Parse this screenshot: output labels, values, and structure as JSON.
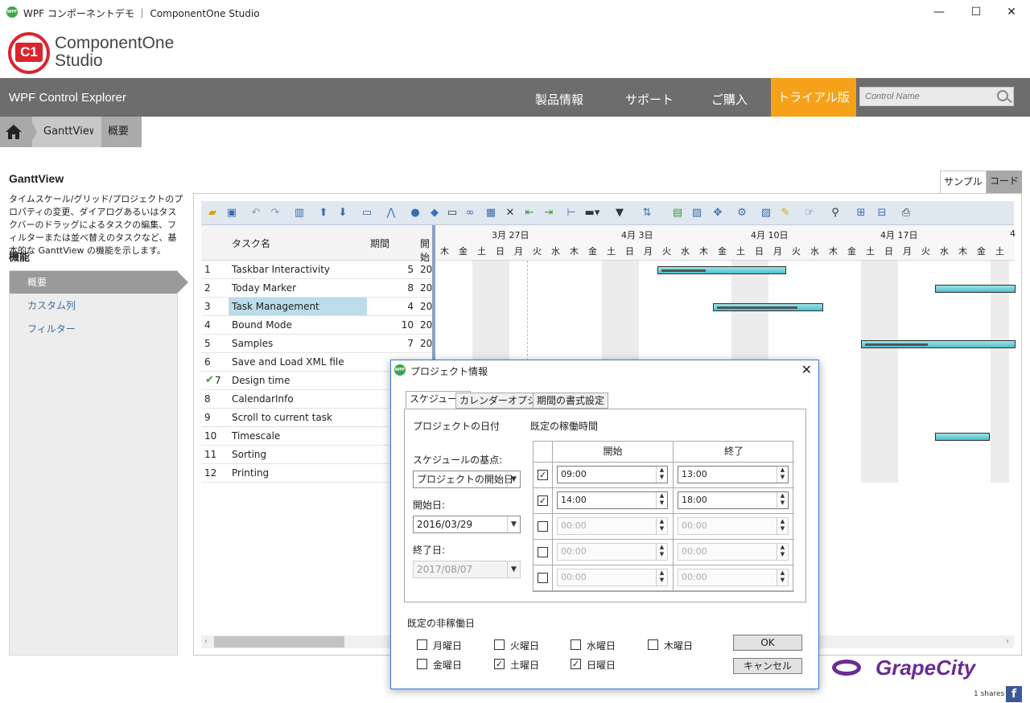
{
  "window": {
    "title": "WPF コンポーネントデモ ｜ ComponentOne Studio",
    "app_icon": "WPF"
  },
  "logo": {
    "mark": "C1",
    "line1": "ComponentOne",
    "line2": "Studio"
  },
  "navbar": {
    "app_title": "WPF Control Explorer",
    "items": [
      "製品情報",
      "サポート",
      "ご購入"
    ],
    "trial": "トライアル版",
    "search_placeholder": "Control Name"
  },
  "breadcrumb": [
    "GanttView",
    "概要"
  ],
  "sidebar": {
    "title": "GanttView",
    "description": "タイムスケール/グリッド/プロジェクトのプロパティの変更、ダイアログあるいはタスクバーのドラッグによるタスクの編集、フィルターまたは並べ替えのタスクなど、基本的な GanttView の機能を示します。",
    "features_label": "機能",
    "items": [
      "概要",
      "カスタム列",
      "フィルター"
    ]
  },
  "tabs": {
    "sample": "サンプル",
    "code": "コード"
  },
  "grid": {
    "columns": {
      "name": "タスク名",
      "duration": "期間",
      "start": "開始"
    },
    "rows": [
      {
        "n": "1",
        "name": "Taskbar Interactivity",
        "dur": "5",
        "start": "20"
      },
      {
        "n": "2",
        "name": "Today Marker",
        "dur": "8",
        "start": "20"
      },
      {
        "n": "3",
        "name": "Task Management",
        "dur": "4",
        "start": "20"
      },
      {
        "n": "4",
        "name": "Bound Mode",
        "dur": "10",
        "start": "20"
      },
      {
        "n": "5",
        "name": "Samples",
        "dur": "7",
        "start": "20"
      },
      {
        "n": "6",
        "name": "Save and Load XML file",
        "dur": "",
        "start": ""
      },
      {
        "n": "7",
        "name": "Design time",
        "dur": "",
        "start": ""
      },
      {
        "n": "8",
        "name": "CalendarInfo",
        "dur": "",
        "start": ""
      },
      {
        "n": "9",
        "name": "Scroll to current task",
        "dur": "",
        "start": ""
      },
      {
        "n": "10",
        "name": "Timescale",
        "dur": "",
        "start": ""
      },
      {
        "n": "11",
        "name": "Sorting",
        "dur": "",
        "start": ""
      },
      {
        "n": "12",
        "name": "Printing",
        "dur": "",
        "start": ""
      }
    ]
  },
  "chart": {
    "weeks": [
      "3月 27日",
      "4月 3日",
      "4月 10日",
      "4月 17日",
      "4"
    ],
    "days": [
      "木",
      "金",
      "土",
      "日",
      "月",
      "火",
      "水",
      "木",
      "金",
      "土",
      "日",
      "月",
      "火",
      "水",
      "木",
      "金",
      "土",
      "日",
      "月",
      "火",
      "水",
      "木",
      "金",
      "土",
      "日",
      "月",
      "火",
      "水",
      "木",
      "金",
      "土"
    ]
  },
  "dialog": {
    "title": "プロジェクト情報",
    "tabs": [
      "スケジュール",
      "カレンダーオプション",
      "期間の書式設定"
    ],
    "project_date_label": "プロジェクトの日付",
    "work_hours_label": "既定の稼働時間",
    "schedule_base_label": "スケジュールの基点:",
    "schedule_base_value": "プロジェクトの開始日",
    "start_label": "開始日:",
    "start_value": "2016/03/29",
    "end_label": "終了日:",
    "end_value": "2017/08/07",
    "hours_header": {
      "start": "開始",
      "end": "終了"
    },
    "hours": [
      {
        "checked": "✓",
        "start": "09:00",
        "end": "13:00"
      },
      {
        "checked": "✓",
        "start": "14:00",
        "end": "18:00"
      },
      {
        "checked": "",
        "start": "00:00",
        "end": "00:00"
      },
      {
        "checked": "",
        "start": "00:00",
        "end": "00:00"
      },
      {
        "checked": "",
        "start": "00:00",
        "end": "00:00"
      }
    ],
    "nonwork_label": "既定の非稼働日",
    "weekdays": {
      "mon": "月曜日",
      "tue": "火曜日",
      "wed": "水曜日",
      "thu": "木曜日",
      "fri": "金曜日",
      "sat": "土曜日",
      "sun": "日曜日"
    },
    "sat_checked": "✓",
    "sun_checked": "✓",
    "ok": "OK",
    "cancel": "キャンセル"
  },
  "footer": {
    "brand": "GrapeCity",
    "shares": "1 shares",
    "fb": "f"
  }
}
